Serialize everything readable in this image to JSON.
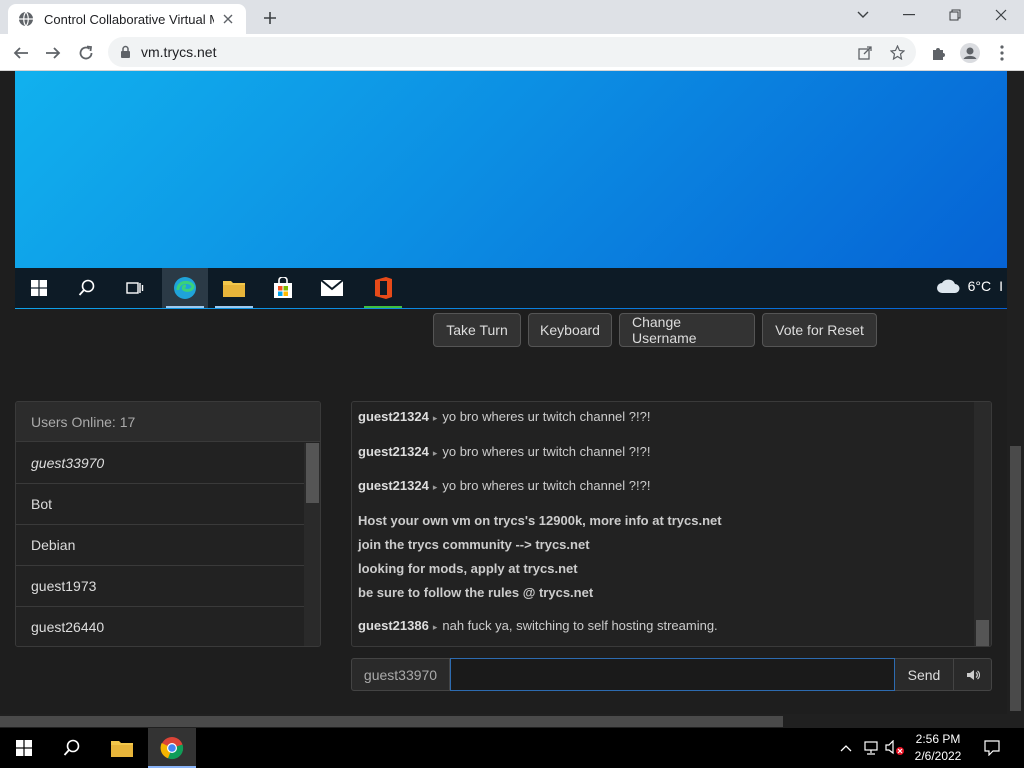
{
  "browser": {
    "tab_title": "Control Collaborative Virtual Mac",
    "url": "vm.trycs.net"
  },
  "vm": {
    "weather_temp": "6°C",
    "weather_extra": "I",
    "buttons": {
      "take_turn": "Take Turn",
      "keyboard": "Keyboard",
      "change_username": "Change Username",
      "vote_reset": "Vote for Reset"
    }
  },
  "users": {
    "header": "Users Online: 17",
    "list": [
      "guest33970",
      "Bot",
      "Debian",
      "guest1973",
      "guest26440"
    ]
  },
  "chat": {
    "messages": [
      {
        "user": "guest21324",
        "text": "yo bro wheres ur twitch channel ?!?!"
      },
      {
        "user": "guest21324",
        "text": "yo bro wheres ur twitch channel ?!?!"
      },
      {
        "user": "guest21324",
        "text": "yo bro wheres ur twitch channel ?!?!"
      }
    ],
    "system_lines": [
      "Host your own vm on trycs's 12900k, more info at trycs.net",
      "join the trycs community --> trycs.net",
      "looking for mods, apply at trycs.net",
      "be sure to follow the rules @ trycs.net"
    ],
    "last_message": {
      "user": "guest21386",
      "text": "nah fuck ya, switching to self hosting streaming."
    },
    "separator": "▸",
    "username": "guest33970",
    "input_value": "",
    "send_label": "Send"
  },
  "taskbar": {
    "time": "2:56 PM",
    "date": "2/6/2022"
  },
  "colors": {
    "accent": "#2d6bb0",
    "vm_desktop": "#0c8ee3"
  }
}
